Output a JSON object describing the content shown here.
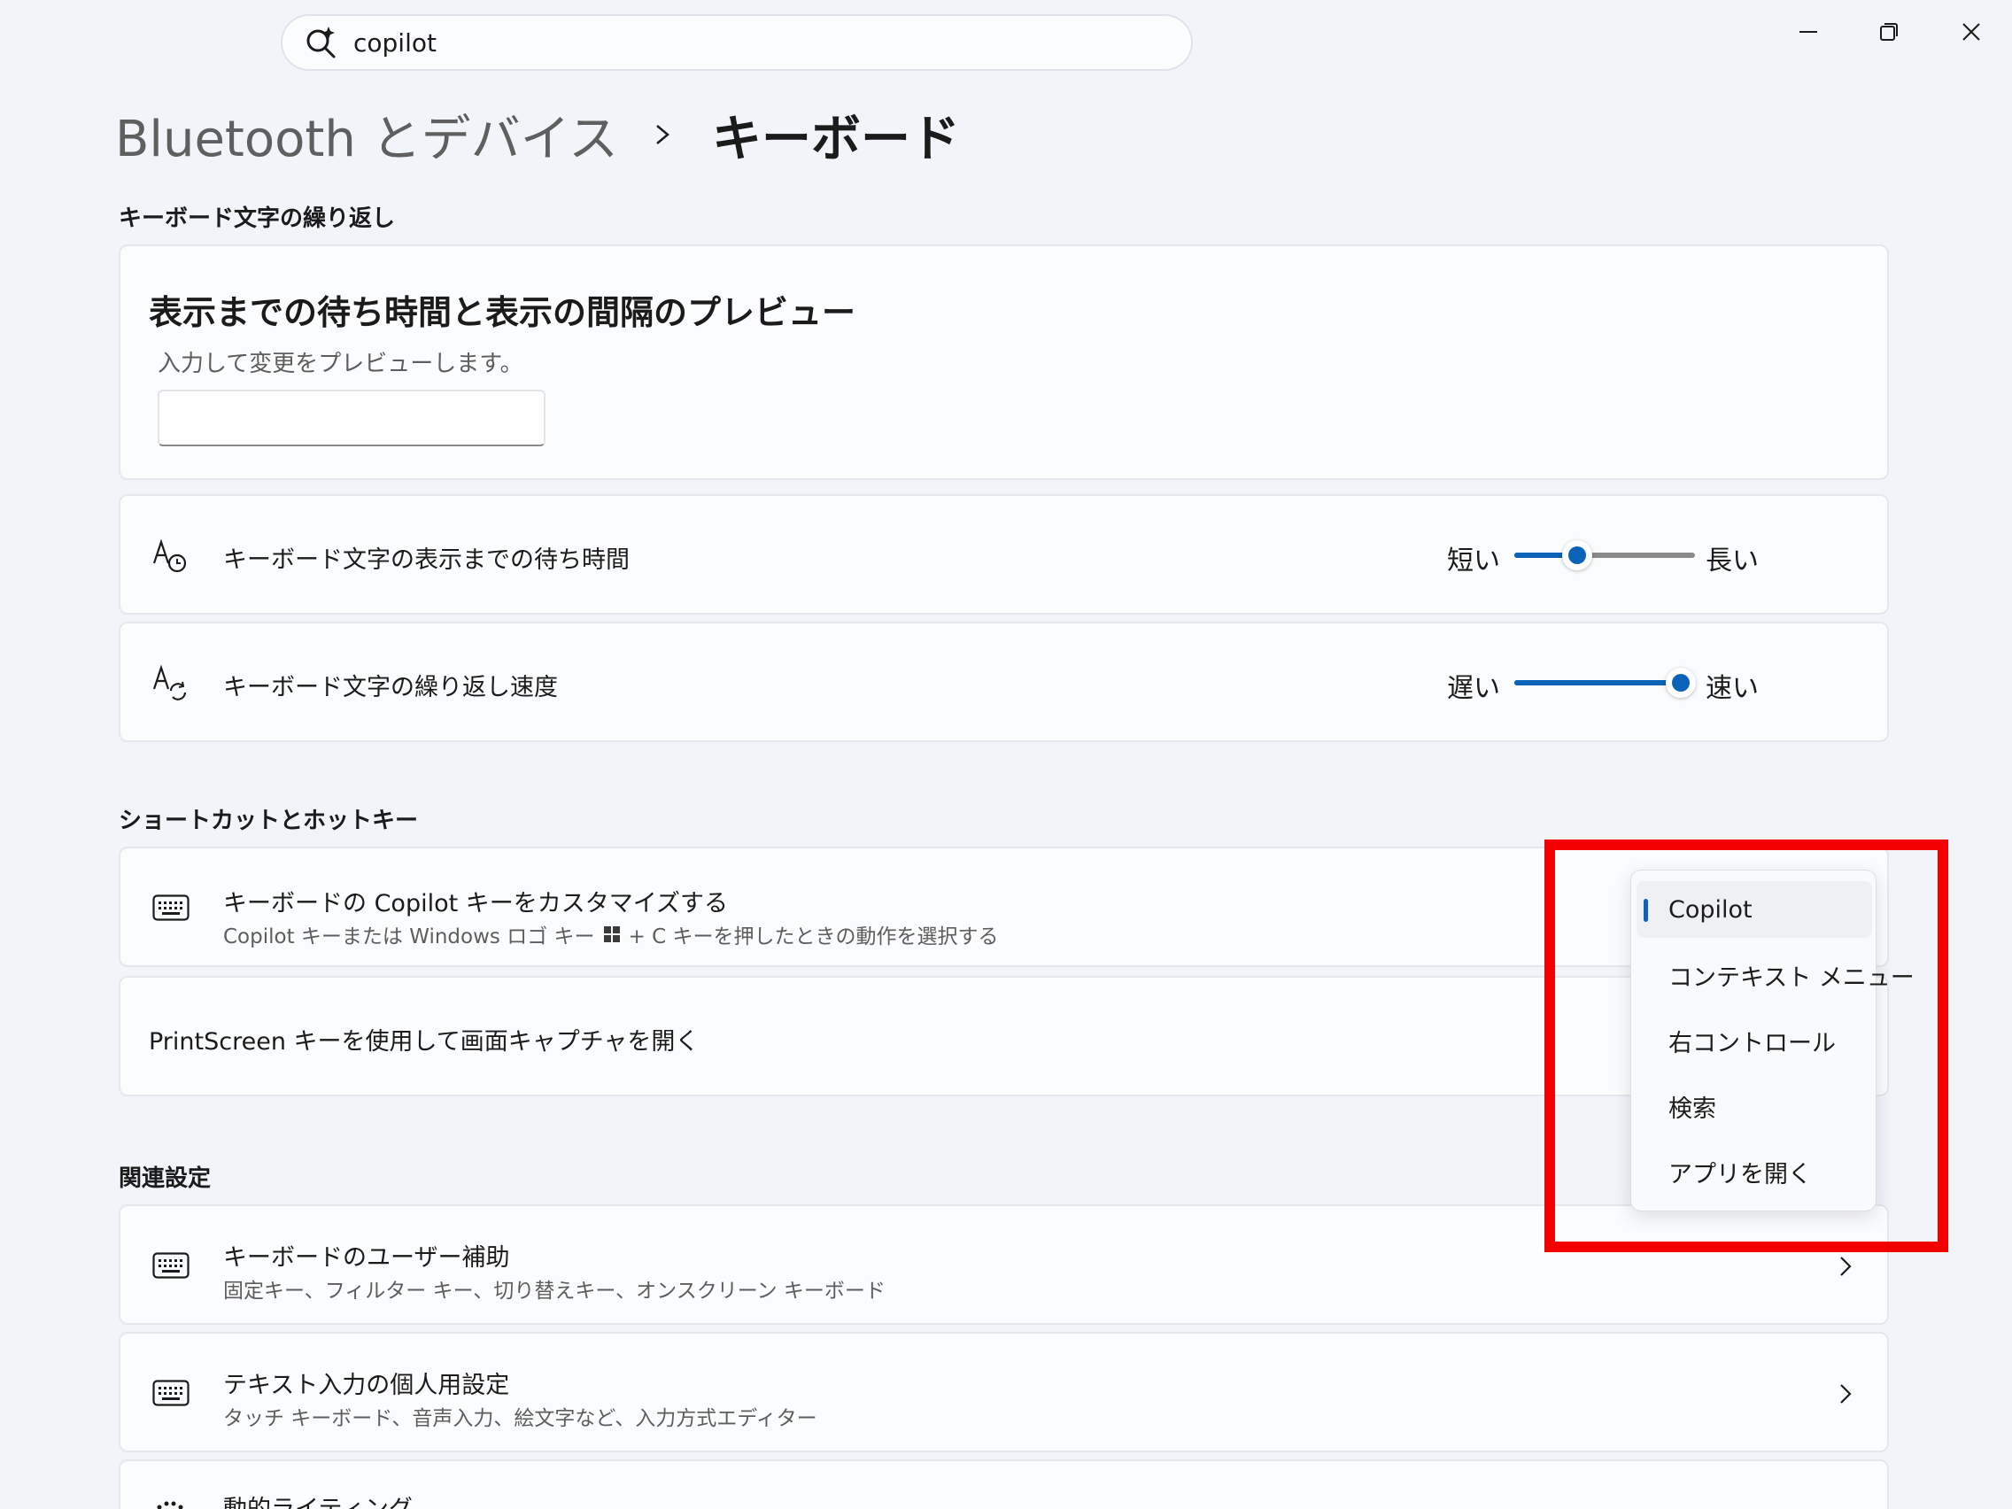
{
  "search": {
    "value": "copilot"
  },
  "breadcrumb": {
    "parent": "Bluetooth とデバイス",
    "current": "キーボード"
  },
  "sections": {
    "repeat": "キーボード文字の繰り返し",
    "shortcuts": "ショートカットとホットキー",
    "related": "関連設定"
  },
  "preview": {
    "heading": "表示までの待ち時間と表示の間隔のプレビュー",
    "description": "入力して変更をプレビューします。",
    "input_value": ""
  },
  "delay": {
    "label": "キーボード文字の表示までの待ち時間",
    "min_label": "短い",
    "max_label": "長い",
    "value": 0.35
  },
  "rate": {
    "label": "キーボード文字の繰り返し速度",
    "min_label": "遅い",
    "max_label": "速い",
    "value": 0.92
  },
  "copilot_key": {
    "title": "キーボードの Copilot キーをカスタマイズする",
    "subtitle_prefix": "Copilot キーまたは Windows ロゴ キー",
    "subtitle_suffix": "+ C キーを押したときの動作を選択する"
  },
  "printscreen": {
    "title": "PrintScreen キーを使用して画面キャプチャを開く"
  },
  "menu": {
    "items": [
      {
        "label": "Copilot",
        "selected": true
      },
      {
        "label": "コンテキスト メニュー",
        "selected": false
      },
      {
        "label": "右コントロール",
        "selected": false
      },
      {
        "label": "検索",
        "selected": false
      },
      {
        "label": "アプリを開く",
        "selected": false
      }
    ]
  },
  "related": [
    {
      "title": "キーボードのユーザー補助",
      "subtitle": "固定キー、フィルター キー、切り替えキー、オンスクリーン キーボード"
    },
    {
      "title": "テキスト入力の個人用設定",
      "subtitle": "タッチ キーボード、音声入力、絵文字など、入力方式エディター"
    },
    {
      "title": "動的ライティング",
      "subtitle": ""
    }
  ],
  "colors": {
    "accent": "#0a63b8",
    "track_inactive": "#8a8a8a",
    "highlight": "#f20000",
    "background": "#f1f4f9"
  },
  "icons": {
    "search": "copilot-search-icon",
    "minimize": "minimize-icon",
    "maximize": "restore-icon",
    "close": "close-icon",
    "delay": "character-clock-icon",
    "rate": "character-repeat-icon",
    "keyboard": "keyboard-icon",
    "windows": "windows-logo-icon",
    "chevron": "chevron-right-icon"
  }
}
